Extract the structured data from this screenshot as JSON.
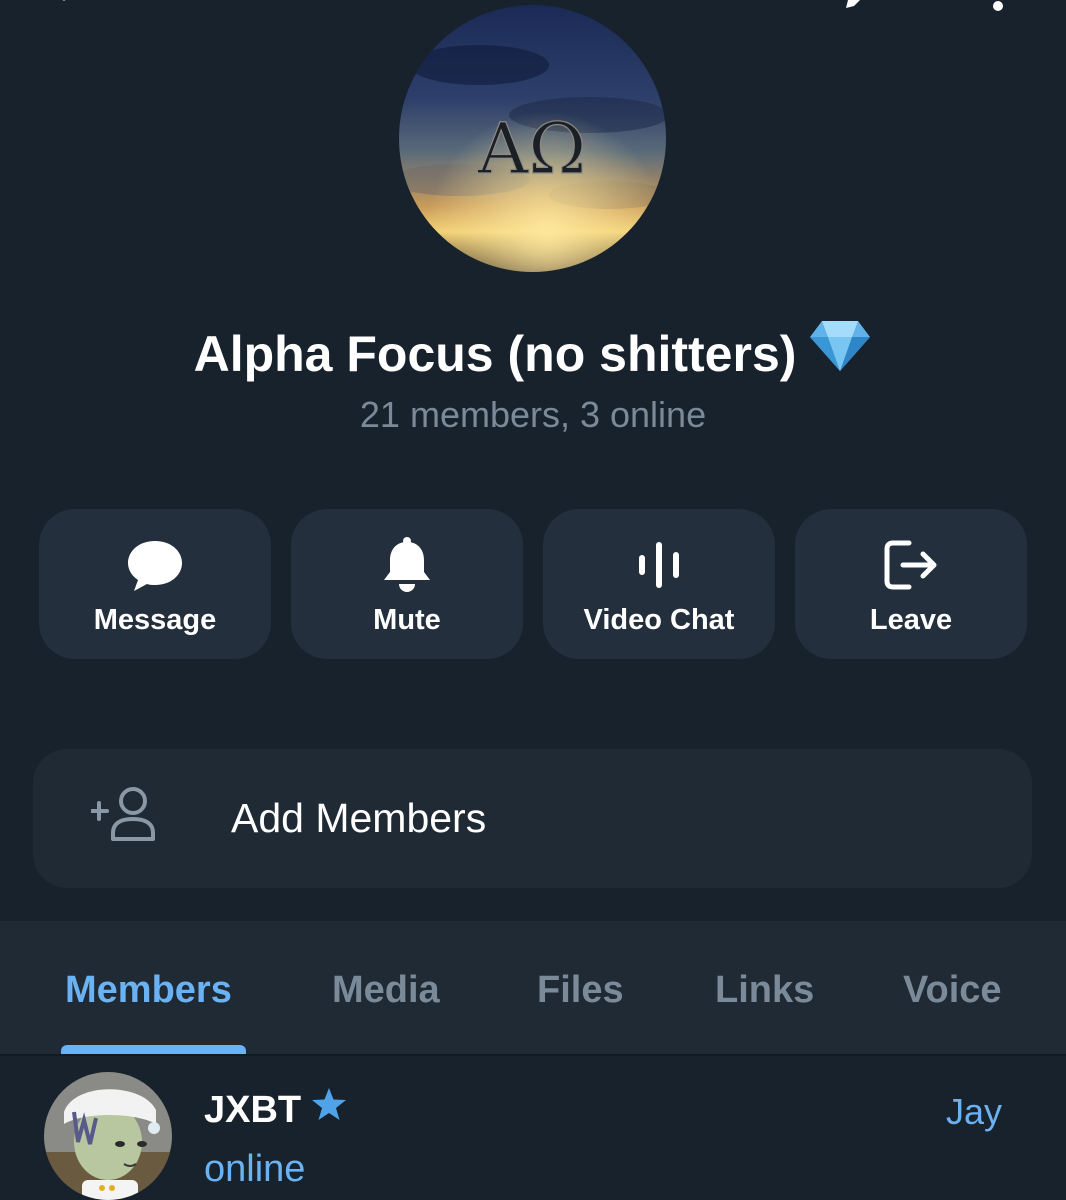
{
  "header": {
    "title": "Alpha Focus (no shitters)",
    "subtitle": "21 members, 3 online",
    "avatar_letters": "ΑΩ"
  },
  "actions": [
    {
      "label": "Message",
      "icon": "chat-bubble-icon"
    },
    {
      "label": "Mute",
      "icon": "bell-icon"
    },
    {
      "label": "Video Chat",
      "icon": "voice-wave-icon"
    },
    {
      "label": "Leave",
      "icon": "leave-icon"
    }
  ],
  "add_members": {
    "label": "Add Members",
    "icon": "add-user-icon"
  },
  "tabs": [
    {
      "label": "Members",
      "active": true
    },
    {
      "label": "Media",
      "active": false
    },
    {
      "label": "Files",
      "active": false
    },
    {
      "label": "Links",
      "active": false
    },
    {
      "label": "Voice",
      "active": false
    }
  ],
  "members": [
    {
      "name": "JXBT",
      "status": "online",
      "tag": "Jay"
    }
  ],
  "colors": {
    "background": "#18222d",
    "card": "#232f3c",
    "accent": "#6ab2f2",
    "muted_text": "#7b8a99"
  }
}
